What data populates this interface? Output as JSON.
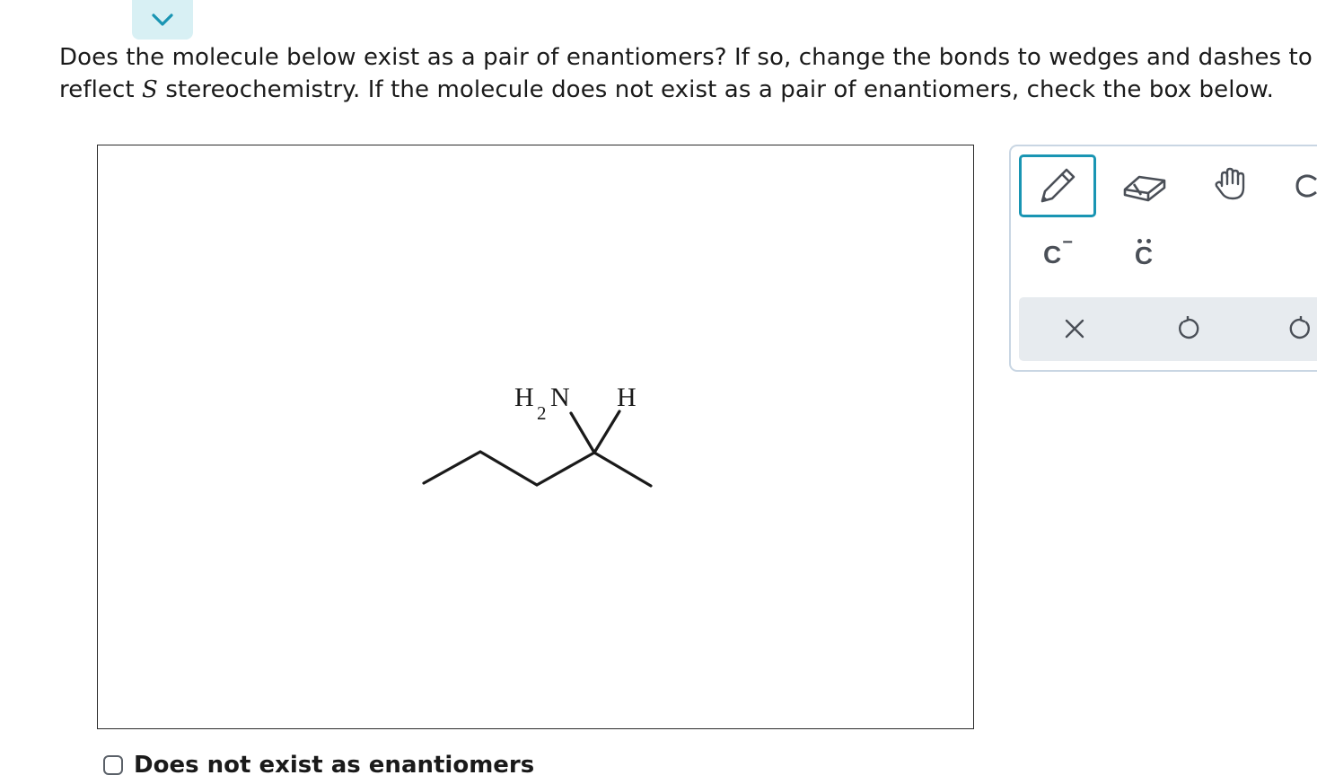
{
  "collapse": {
    "icon": "chevron-down-icon",
    "color": "#1995b3"
  },
  "question": {
    "line1": "Does the molecule below exist as a pair of enantiomers? If so, change the bonds to wedges and dashes to",
    "line2_before": "reflect ",
    "line2_var": "S",
    "line2_after": " stereochemistry. If the molecule does not exist as a pair of enantiomers, check the box below."
  },
  "molecule": {
    "amine_h": "H",
    "amine_sub": "2",
    "amine_n": "N",
    "hydrogen": "H"
  },
  "toolbar": {
    "tools": [
      {
        "name": "pencil-tool",
        "icon": "pencil-icon",
        "selected": true
      },
      {
        "name": "eraser-tool",
        "icon": "eraser-icon",
        "selected": false
      },
      {
        "name": "pan-tool",
        "icon": "hand-icon",
        "selected": false
      },
      {
        "name": "rotate-tool",
        "icon": "partially-visible-icon",
        "selected": false
      }
    ],
    "charge_label": "C",
    "charge_sign": "−",
    "lone_pair_label": "C",
    "actions": [
      {
        "name": "clear-button",
        "icon": "close-icon"
      },
      {
        "name": "undo-button",
        "icon": "undo-icon"
      },
      {
        "name": "redo-button",
        "icon": "redo-icon"
      }
    ],
    "accent_color": "#1995b3"
  },
  "checkbox": {
    "label": "Does not exist as enantiomers",
    "checked": false
  }
}
